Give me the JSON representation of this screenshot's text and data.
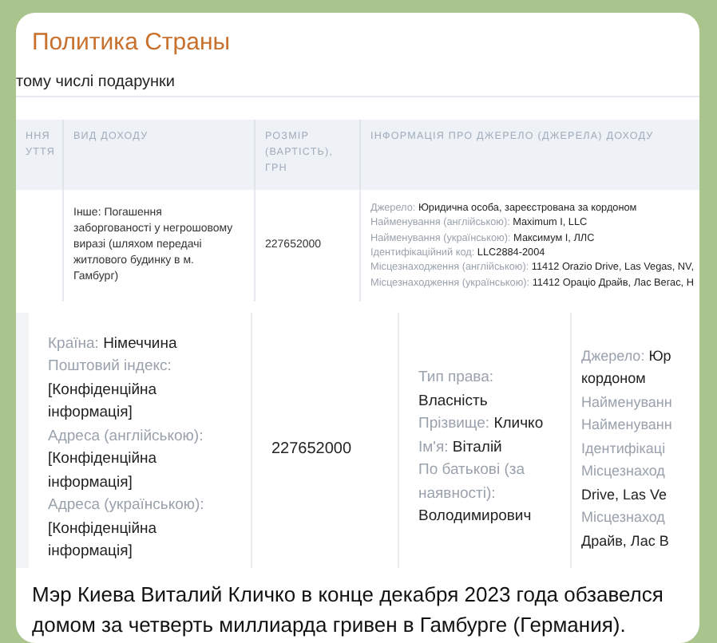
{
  "channel": {
    "title": "Политика Страны"
  },
  "screenshot_1": {
    "intro": "тому числі подарунки",
    "columns": [
      {
        "lines": [
          "ННЯ",
          "УТТЯ"
        ]
      },
      {
        "lines": [
          "ВИД ДОХОДУ"
        ]
      },
      {
        "lines": [
          "РОЗМІР",
          "(ВАРТІСТЬ),",
          "ГРН"
        ]
      },
      {
        "lines": [
          "ІНФОРМАЦІЯ ПРО ДЖЕРЕЛО (ДЖЕРЕЛА) ДОХОДУ"
        ]
      }
    ],
    "row": {
      "income_type": "Інше: Погашення заборгованості у негрошовому виразі (шляхом передачі житлового будинку в м. Гамбург)",
      "amount": "227652000",
      "source": [
        {
          "label": "Джерело:",
          "value": "Юридична особа, зареєстрована за кордоном"
        },
        {
          "label": "Найменування (англійською):",
          "value": "Maximum I, LLC"
        },
        {
          "label": "Найменування (українською):",
          "value": "Максимум І, ЛЛС"
        },
        {
          "label": "Ідентифікаційний код:",
          "value": "LLC2884-2004"
        },
        {
          "label": "Місцезнаходження (англійською):",
          "value": "11412 Orazio Drive, Las Vegas, NV,"
        },
        {
          "label": "Місцезнаходження (українською):",
          "value": "11412 Ораціо Драйв, Лас Вегас, Н"
        }
      ]
    }
  },
  "screenshot_2": {
    "location": [
      {
        "label": "Країна:",
        "value": "Німеччина"
      },
      {
        "label": "Поштовий індекс:",
        "value": "[Конфіденційна інформація]"
      },
      {
        "label": "Адреса (англійською):",
        "value": "[Конфіденційна інформація]"
      },
      {
        "label": "Адреса (українською):",
        "value": "[Конфіденційна інформація]"
      }
    ],
    "amount": "227652000",
    "rights": [
      {
        "label": "Тип права:",
        "value": "Власність"
      },
      {
        "label": "Прізвище:",
        "value": "Кличко"
      },
      {
        "label": "Ім'я:",
        "value": "Віталій"
      },
      {
        "label": "По батькові (за наявності):",
        "value": "Володимирович"
      }
    ],
    "source_cut": [
      {
        "label": "Джерело:",
        "value": "Юр"
      },
      {
        "value": "кордоном"
      },
      {
        "label": "Найменуванн"
      },
      {
        "label": "Найменуванн"
      },
      {
        "label": "Ідентифікаці"
      },
      {
        "label": "Місцезнаход"
      },
      {
        "value": "Drive, Las Ve"
      },
      {
        "label": "Місцезнаход"
      },
      {
        "value": "Драйв, Лас В"
      }
    ]
  },
  "caption": "Мэр Киева Виталий Кличко в конце декабря 2023 года обзавелся домом за четверть миллиарда гривен в Гамбурге (Германия)."
}
